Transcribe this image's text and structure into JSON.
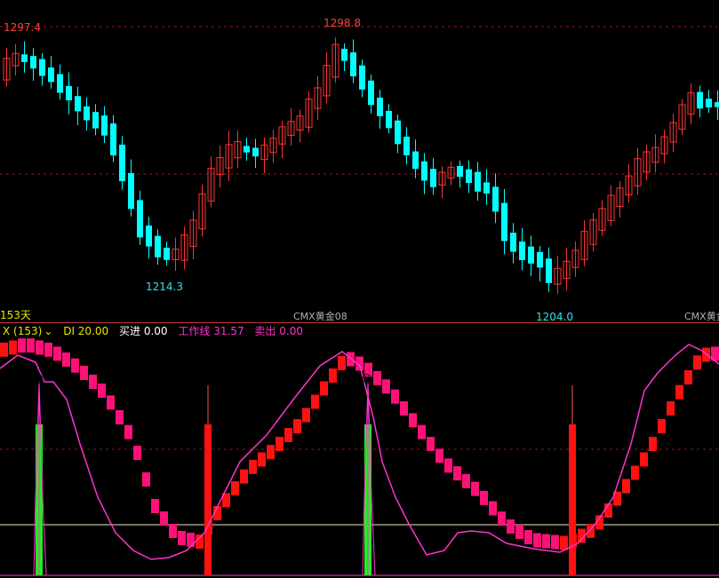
{
  "colors": {
    "up": "#ff3232",
    "down": "#00ffff",
    "line": "#ff33cc",
    "grid": "#8b1a1a",
    "green": "#22ee22",
    "yellow": "#e6e600"
  },
  "upper": {
    "price_labels": {
      "high_left": "1297.4",
      "high_mid": "1298.8",
      "low_left": "1214.3",
      "low_right": "1204.0"
    },
    "days_label": "153天",
    "watermark_left": "CMX黄金08",
    "watermark_right": "CMX黄金"
  },
  "indicator": {
    "name": "X (153)",
    "dropdown_icon": "chevron-down-icon",
    "di": "DI 20.00",
    "buy_label": "买进",
    "buy_value": "0.00",
    "work_label": "工作线",
    "work_value": "31.57",
    "sell_label": "卖出",
    "sell_value": "0.00"
  },
  "smiley_icon": "grinning-face-icon"
}
